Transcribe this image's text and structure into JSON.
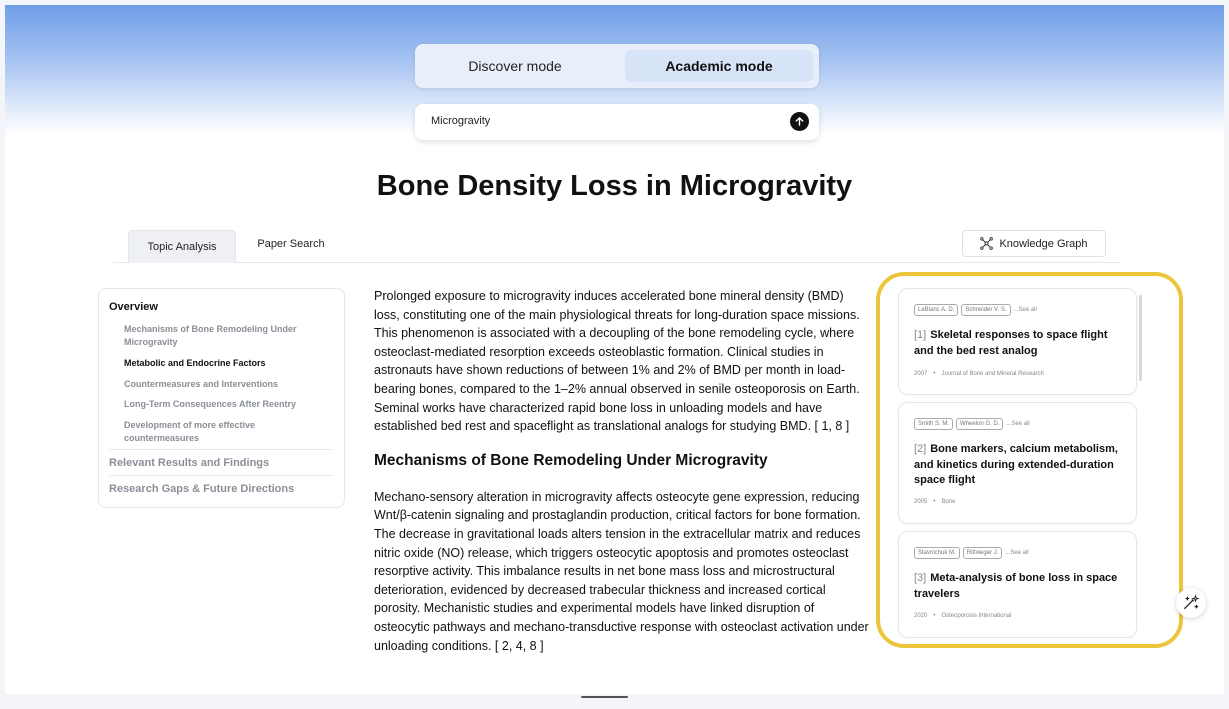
{
  "modes": {
    "discover_label": "Discover mode",
    "academic_label": "Academic mode",
    "selected": "Academic mode"
  },
  "search": {
    "value": "Microgravity",
    "submit_icon": "arrow-up-icon"
  },
  "page": {
    "title": "Bone Density Loss in Microgravity"
  },
  "tabs": [
    {
      "label": "Topic Analysis",
      "selected": true
    },
    {
      "label": "Paper Search",
      "selected": false
    }
  ],
  "knowledge_graph": {
    "label": "Knowledge Graph",
    "icon": "graph-nodes-icon"
  },
  "toc": {
    "overview": "Overview",
    "items": [
      {
        "label": "Mechanisms of Bone Remodeling Under Microgravity",
        "active": false
      },
      {
        "label": "Metabolic and Endocrine Factors",
        "active": true
      },
      {
        "label": "Countermeasures and Interventions",
        "active": false
      },
      {
        "label": "Long-Term Consequences After Reentry",
        "active": false
      },
      {
        "label": "Development of more effective countermeasures",
        "active": false
      }
    ],
    "relevant": "Relevant Results and Findings",
    "gaps": "Research Gaps & Future Directions"
  },
  "article": {
    "intro": "Prolonged exposure to microgravity induces accelerated bone mineral density (BMD) loss, constituting one of the main physiological threats for long-duration space missions. This phenomenon is associated with a decoupling of the bone remodeling cycle, where osteoclast-mediated resorption exceeds osteoblastic formation. Clinical studies in astronauts have shown reductions of between 1% and 2% of BMD per month in load-bearing bones, compared to the 1–2% annual observed in senile osteoporosis on Earth. Seminal works have characterized rapid bone loss in unloading models and have established bed rest and spaceflight as translational analogs for studying BMD. [ 1, 8 ]",
    "section_heading": "Mechanisms of Bone Remodeling Under Microgravity",
    "section_text": "Mechano-sensory alteration in microgravity affects osteocyte gene expression, reducing Wnt/β-catenin signaling and prostaglandin production, critical factors for bone formation. The decrease in gravitational loads alters tension in the extracellular matrix and reduces nitric oxide (NO) release, which triggers osteocytic apoptosis and promotes osteoclast resorptive activity. This imbalance results in net bone mass loss and microstructural deterioration, evidenced by decreased trabecular thickness and increased cortical porosity. Mechanistic studies and experimental models have linked disruption of osteocytic pathways and mechano-transductive response with osteoclast activation under unloading conditions. [ 2, 4, 8 ]"
  },
  "references": [
    {
      "num": "[1]",
      "authors": [
        "LeBlanc A. D.",
        "Schneider V. S."
      ],
      "see_all": "...See all",
      "title": "Skeletal responses to space flight and the bed rest analog",
      "year": "2007",
      "journal": "Journal of Bone and Mineral Research"
    },
    {
      "num": "[2]",
      "authors": [
        "Smith S. M.",
        "Wheelon G. D."
      ],
      "see_all": "...See all",
      "title": "Bone markers, calcium metabolism, and kinetics during extended-duration space flight",
      "year": "2005",
      "journal": "Bone"
    },
    {
      "num": "[3]",
      "authors": [
        "Stavnichuk M.",
        "Rittweger J."
      ],
      "see_all": "...See all",
      "title": "Meta-analysis of bone loss in space travelers",
      "year": "2020",
      "journal": "Osteoporosis International"
    }
  ],
  "colors": {
    "highlight": "#ecc53a",
    "header_gradient_top": "#6f9ee8",
    "selected_mode_bg": "#d7e3f6"
  },
  "fab_icon": "ai-sparkle-icon"
}
